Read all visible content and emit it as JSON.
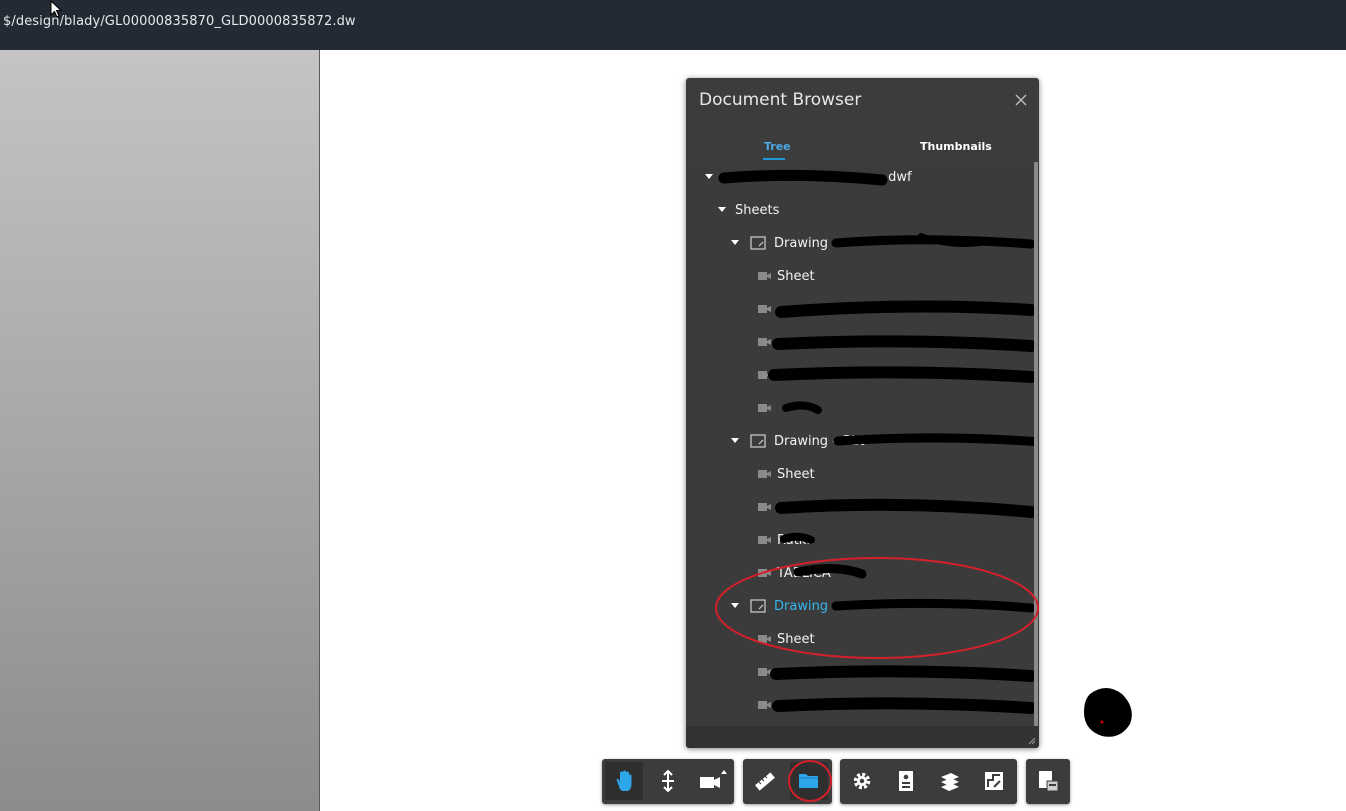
{
  "window": {
    "path": "$/design/blady/GL00000835870_GLD0000835872.dw"
  },
  "document_browser": {
    "title": "Document Browser",
    "tabs": [
      {
        "label": "Tree",
        "active": true
      },
      {
        "label": "Thumbnails",
        "active": false
      }
    ],
    "tree": [
      {
        "label": ".dwf",
        "level": 0,
        "expanded": true,
        "icon": "none"
      },
      {
        "label": "Sheets",
        "level": 1,
        "expanded": true,
        "icon": "none"
      },
      {
        "label": "Drawing -",
        "level": 2,
        "expanded": true,
        "icon": "drawing-icon"
      },
      {
        "label": "Sheet",
        "level": 3,
        "icon": "camera-icon"
      },
      {
        "label": "",
        "level": 3,
        "icon": "camera-icon"
      },
      {
        "label": "",
        "level": 3,
        "icon": "camera-icon"
      },
      {
        "label": "",
        "level": 3,
        "icon": "camera-icon"
      },
      {
        "label": "",
        "level": 3,
        "icon": "camera-icon"
      },
      {
        "label": "Drawing - GL0",
        "level": 2,
        "expanded": true,
        "icon": "drawing-icon"
      },
      {
        "label": "Sheet",
        "level": 3,
        "icon": "camera-icon"
      },
      {
        "label": "",
        "level": 3,
        "icon": "camera-icon"
      },
      {
        "label": "Ratka",
        "level": 3,
        "icon": "camera-icon"
      },
      {
        "label": "TABLICA",
        "level": 3,
        "icon": "camera-icon"
      },
      {
        "label": "Drawing -",
        "level": 2,
        "expanded": true,
        "icon": "drawing-icon",
        "selected": true
      },
      {
        "label": "Sheet",
        "level": 3,
        "icon": "camera-icon"
      },
      {
        "label": "",
        "level": 3,
        "icon": "camera-icon"
      },
      {
        "label": "",
        "level": 3,
        "icon": "camera-icon"
      }
    ]
  },
  "toolbar": {
    "groups": [
      {
        "tools": [
          {
            "name": "pan-tool",
            "icon": "hand-icon",
            "active": true
          },
          {
            "name": "zoom-tool",
            "icon": "zoom-arrows-icon",
            "active": false
          },
          {
            "name": "camera-tool",
            "icon": "camera-icon",
            "active": false
          }
        ]
      },
      {
        "tools": [
          {
            "name": "measure-tool",
            "icon": "ruler-icon",
            "active": false
          },
          {
            "name": "document-browser-tool",
            "icon": "folder-icon",
            "active": true
          }
        ]
      },
      {
        "tools": [
          {
            "name": "settings-tool",
            "icon": "gear-icon",
            "active": false
          },
          {
            "name": "properties-tool",
            "icon": "properties-icon",
            "active": false
          },
          {
            "name": "layers-tool",
            "icon": "layers-icon",
            "active": false
          },
          {
            "name": "sheet-tool",
            "icon": "sheet-icon",
            "active": false
          }
        ]
      },
      {
        "tools": [
          {
            "name": "export-tool",
            "icon": "export-icon",
            "active": false
          }
        ]
      }
    ]
  },
  "colors": {
    "topbar": "#232a33",
    "panel": "#3c3c3c",
    "accent": "#2196d6",
    "highlight": "#35b5ee",
    "annotation": "#d4202a"
  }
}
